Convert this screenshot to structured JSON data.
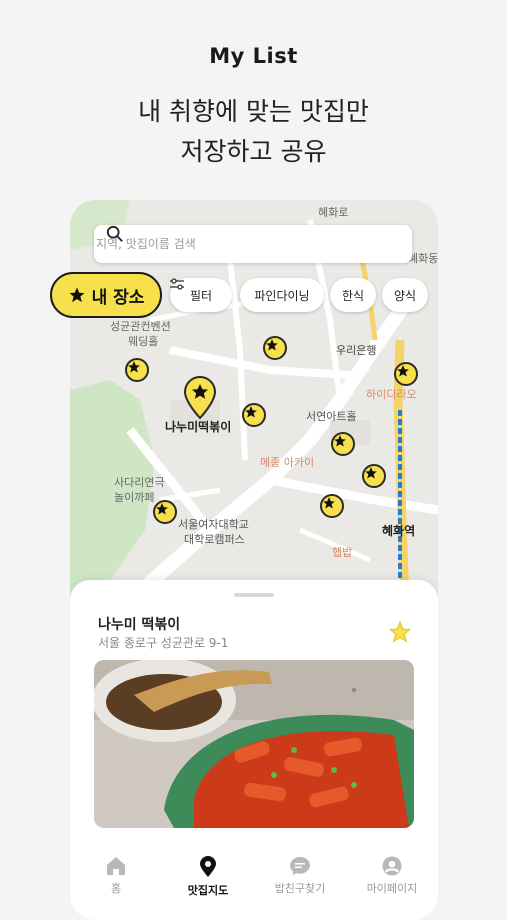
{
  "hero": {
    "title": "My List",
    "subtitle_line1": "내 취향에 맞는 맛집만",
    "subtitle_line2": "저장하고 공유"
  },
  "search": {
    "placeholder": "지역, 맛집이름 검색"
  },
  "filters": {
    "my_places": "내 장소",
    "filter": "필터",
    "chips": [
      "파인다이닝",
      "한식",
      "양식"
    ]
  },
  "map": {
    "labels": {
      "seonggyun": "성균관컨벤션",
      "wedding": "웨딩홀",
      "woori": "우리은행",
      "hidi": "하이디라오",
      "nanumi": "나누미떡볶이",
      "seoyeon": "서연아트홀",
      "mejong": "메종 아카이",
      "sadari": "사다리연극",
      "nori": "놀이까페",
      "seoulwomen": "서울여자대학교",
      "campus": "대학로캠퍼스",
      "hyehwa": "혜화역",
      "haetbap": "햅밥",
      "hyehwa_dong": "혜화동",
      "street": "혜화로"
    }
  },
  "place": {
    "name": "나누미 떡볶이",
    "address": "서울 종로구 성균관로 9-1"
  },
  "tabs": [
    {
      "label": "홈",
      "icon": "home-icon",
      "active": false
    },
    {
      "label": "맛집지도",
      "icon": "map-pin-icon",
      "active": true
    },
    {
      "label": "밥친구찾기",
      "icon": "chat-icon",
      "active": false
    },
    {
      "label": "마이페이지",
      "icon": "profile-icon",
      "active": false
    }
  ],
  "colors": {
    "accent": "#f6e04c",
    "background": "#f4f4f4",
    "subway_blue": "#1f7fd6"
  }
}
